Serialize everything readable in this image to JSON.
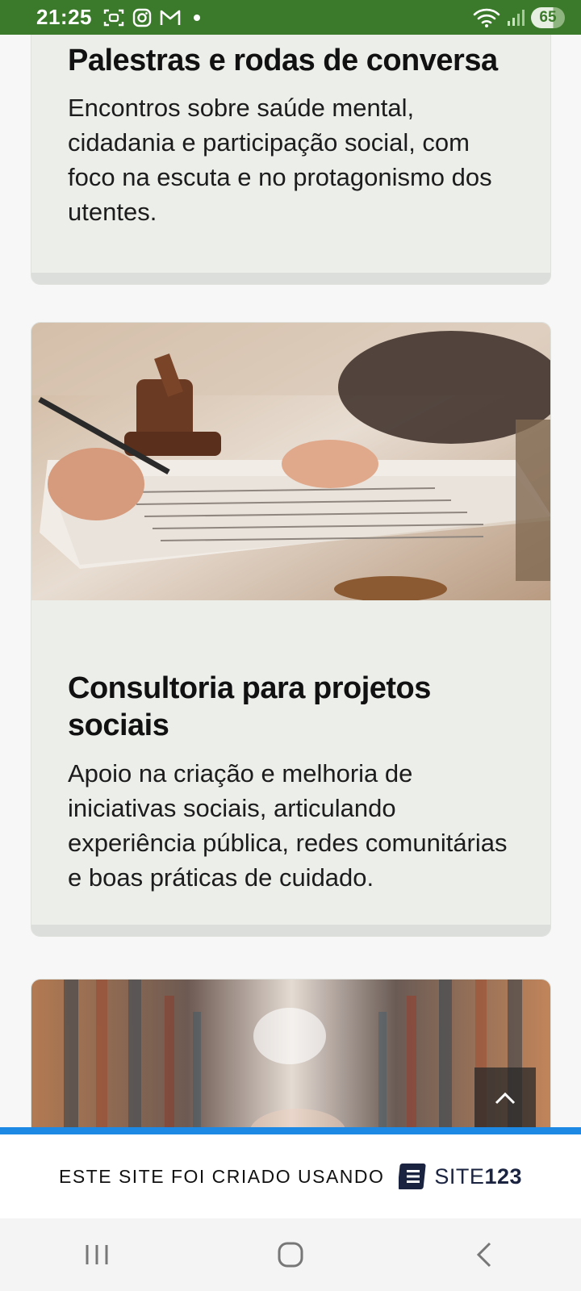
{
  "status": {
    "time": "21:25",
    "battery": "65",
    "icons": [
      "screenshot-icon",
      "instagram-icon",
      "gmail-icon",
      "dot-icon",
      "wifi-icon",
      "signal-icon"
    ]
  },
  "cards": [
    {
      "title": "Palestras e rodas de conversa",
      "text": "Encontros sobre saúde mental, cidadania e participação social, com foco na escuta e no protagonismo dos utentes."
    },
    {
      "title": "Consultoria para projetos sociais",
      "text": "Apoio na criação e melhoria de iniciativas sociais, articulando experiência pública, redes comunitárias e boas práticas de cuidado."
    }
  ],
  "footer": {
    "text": "ESTE SITE FOI CRIADO USANDO",
    "brand_light": "SITE",
    "brand_bold": "123"
  },
  "colors": {
    "status_bar": "#3b7a2a",
    "card_bg": "#eceeea",
    "banner_accent": "#1e88e5",
    "brand": "#1a2340"
  }
}
